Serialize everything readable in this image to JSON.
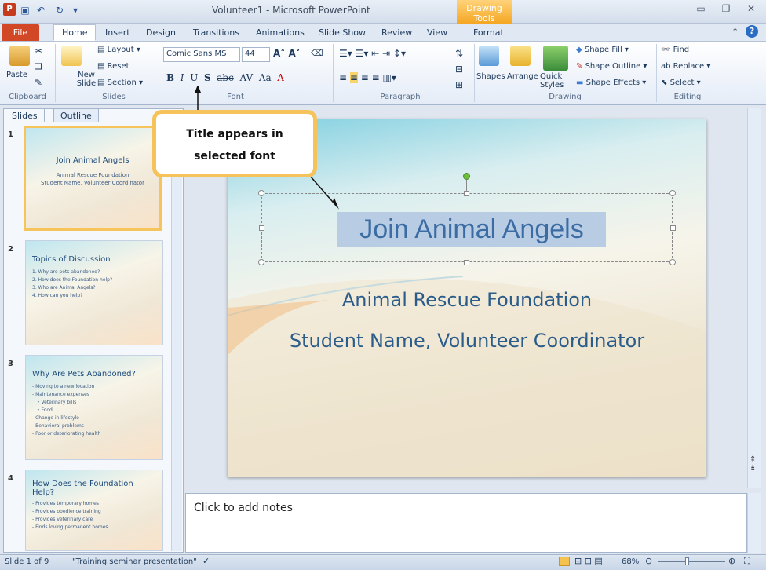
{
  "window": {
    "title": "Volunteer1 - Microsoft PowerPoint",
    "contextual_tab": "Drawing Tools"
  },
  "tabs": [
    "File",
    "Home",
    "Insert",
    "Design",
    "Transitions",
    "Animations",
    "Slide Show",
    "Review",
    "View",
    "Format"
  ],
  "ribbon": {
    "clipboard": {
      "paste": "Paste",
      "label": "Clipboard"
    },
    "slides": {
      "new_slide": "New Slide",
      "layout": "Layout",
      "reset": "Reset",
      "section": "Section",
      "label": "Slides"
    },
    "font": {
      "font_name": "Comic Sans MS",
      "font_size": "44",
      "label": "Font"
    },
    "paragraph": {
      "label": "Paragraph"
    },
    "drawing": {
      "shapes": "Shapes",
      "arrange": "Arrange",
      "quick_styles": "Quick Styles",
      "shape_fill": "Shape Fill",
      "shape_outline": "Shape Outline",
      "shape_effects": "Shape Effects",
      "label": "Drawing"
    },
    "editing": {
      "find": "Find",
      "replace": "Replace",
      "select": "Select",
      "label": "Editing"
    }
  },
  "pane_tabs": {
    "slides": "Slides",
    "outline": "Outline"
  },
  "thumbnails": [
    {
      "num": "1",
      "title": "Join Animal Angels",
      "lines": [
        "Animal Rescue Foundation",
        "Student Name, Volunteer Coordinator"
      ]
    },
    {
      "num": "2",
      "title": "Topics of Discussion",
      "lines": [
        "1. Why are pets abandoned?",
        "2. How does the Foundation help?",
        "3. Who are Animal Angels?",
        "4. How can you help?"
      ]
    },
    {
      "num": "3",
      "title": "Why Are Pets Abandoned?",
      "lines": [
        "- Moving to a new location",
        "- Maintenance expenses",
        "  • Veterinary bills",
        "  • Food",
        "- Change in lifestyle",
        "- Behavioral problems",
        "- Poor or deteriorating health"
      ]
    },
    {
      "num": "4",
      "title": "How Does the Foundation Help?",
      "lines": [
        "- Provides temporary homes",
        "- Provides obedience training",
        "- Provides veterinary care",
        "- Finds loving permanent homes"
      ]
    }
  ],
  "slide": {
    "title": "Join Animal Angels",
    "subtitle1": "Animal Rescue Foundation",
    "subtitle2": "Student Name, Volunteer Coordinator"
  },
  "notes": {
    "placeholder": "Click to add notes"
  },
  "callout": {
    "line1": "Title appears in",
    "line2": "selected font"
  },
  "status": {
    "slide_info": "Slide 1 of 9",
    "theme": "\"Training seminar presentation\"",
    "zoom": "68%"
  }
}
